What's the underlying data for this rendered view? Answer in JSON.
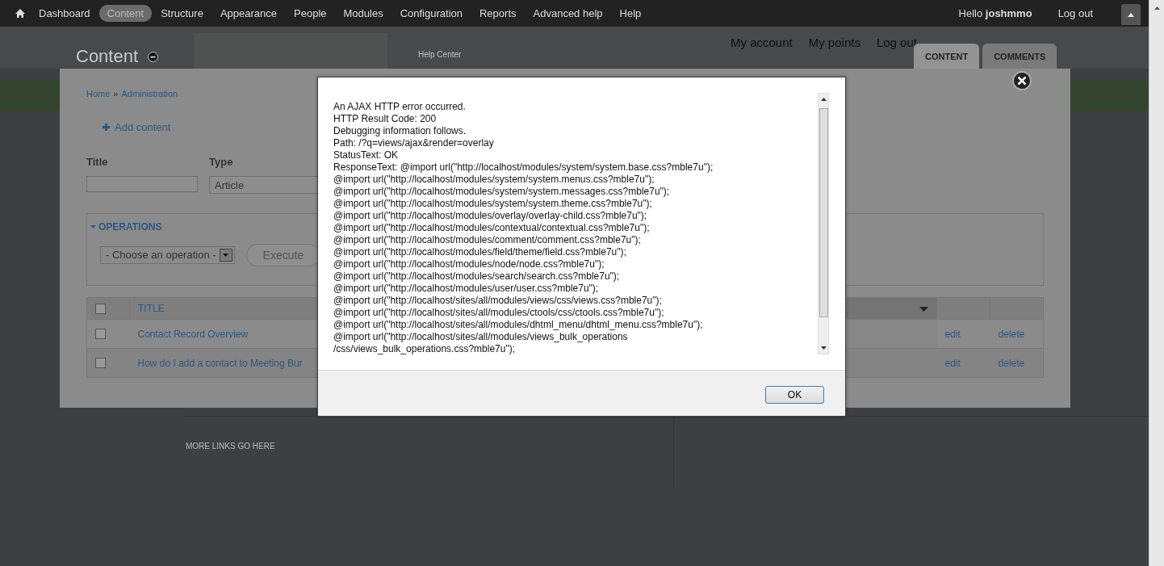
{
  "toolbar": {
    "items": [
      {
        "label": "Dashboard",
        "selected": false
      },
      {
        "label": "Content",
        "selected": true
      },
      {
        "label": "Structure",
        "selected": false
      },
      {
        "label": "Appearance",
        "selected": false
      },
      {
        "label": "People",
        "selected": false
      },
      {
        "label": "Modules",
        "selected": false
      },
      {
        "label": "Configuration",
        "selected": false
      },
      {
        "label": "Reports",
        "selected": false
      },
      {
        "label": "Advanced help",
        "selected": false
      },
      {
        "label": "Help",
        "selected": false
      }
    ],
    "greeting": "Hello **joshmmo**",
    "logout": "Log out"
  },
  "header": {
    "title": "Content",
    "help_link": "Help Center",
    "user_links": [
      "My account",
      "My points",
      "Log out"
    ],
    "tabs": [
      {
        "label": "CONTENT",
        "selected": true
      },
      {
        "label": "COMMENTS",
        "selected": false
      }
    ]
  },
  "overlay": {
    "breadcrumb": [
      "Home",
      "Administration"
    ],
    "breadcrumb_separator": "»",
    "add_content": "Add content",
    "filters": [
      {
        "kind": "text",
        "label": "Title"
      },
      {
        "kind": "select",
        "label": "Type",
        "value": "Article"
      }
    ],
    "operations": {
      "legend": "OPERATIONS",
      "expanded": true,
      "select": "- Choose an operation -",
      "button": "Execute"
    },
    "table": {
      "columns": [
        {
          "kind": "checkbox",
          "checked": false
        },
        {
          "kind": "label",
          "label": "TITLE"
        },
        {
          "kind": "sorted"
        },
        {
          "kind": "blank"
        },
        {
          "kind": "blank"
        }
      ],
      "rows": [
        {
          "checked": false,
          "title": "Contact Record Overview",
          "actions": [
            "edit",
            "delete"
          ]
        },
        {
          "checked": false,
          "title": "How do I add a contact to Meeting Bur",
          "actions": [
            "edit",
            "delete"
          ]
        }
      ]
    }
  },
  "dialog": {
    "lines": [
      "An AJAX HTTP error occurred.",
      "HTTP Result Code: 200",
      "Debugging information follows.",
      "Path: /?q=views/ajax&render=overlay",
      "StatusText: OK",
      "ResponseText: @import url(\"http://localhost/modules/system/system.base.css?mble7u\");",
      "@import url(\"http://localhost/modules/system/system.menus.css?mble7u\");",
      "@import url(\"http://localhost/modules/system/system.messages.css?mble7u\");",
      "@import url(\"http://localhost/modules/system/system.theme.css?mble7u\");",
      "@import url(\"http://localhost/modules/overlay/overlay-child.css?mble7u\");",
      "@import url(\"http://localhost/modules/contextual/contextual.css?mble7u\");",
      "@import url(\"http://localhost/modules/comment/comment.css?mble7u\");",
      "@import url(\"http://localhost/modules/field/theme/field.css?mble7u\");",
      "@import url(\"http://localhost/modules/node/node.css?mble7u\");",
      "@import url(\"http://localhost/modules/search/search.css?mble7u\");",
      "@import url(\"http://localhost/modules/user/user.css?mble7u\");",
      "@import url(\"http://localhost/sites/all/modules/views/css/views.css?mble7u\");",
      "@import url(\"http://localhost/sites/all/modules/ctools/css/ctools.css?mble7u\");",
      "@import url(\"http://localhost/sites/all/modules/dhtml_menu/dhtml_menu.css?mble7u\");",
      "@import url(\"http://localhost/sites/all/modules/views_bulk_operations",
      "/css/views_bulk_operations.css?mble7u\");"
    ],
    "button": "OK"
  },
  "footer": {
    "text": "MORE LINKS GO HERE"
  }
}
